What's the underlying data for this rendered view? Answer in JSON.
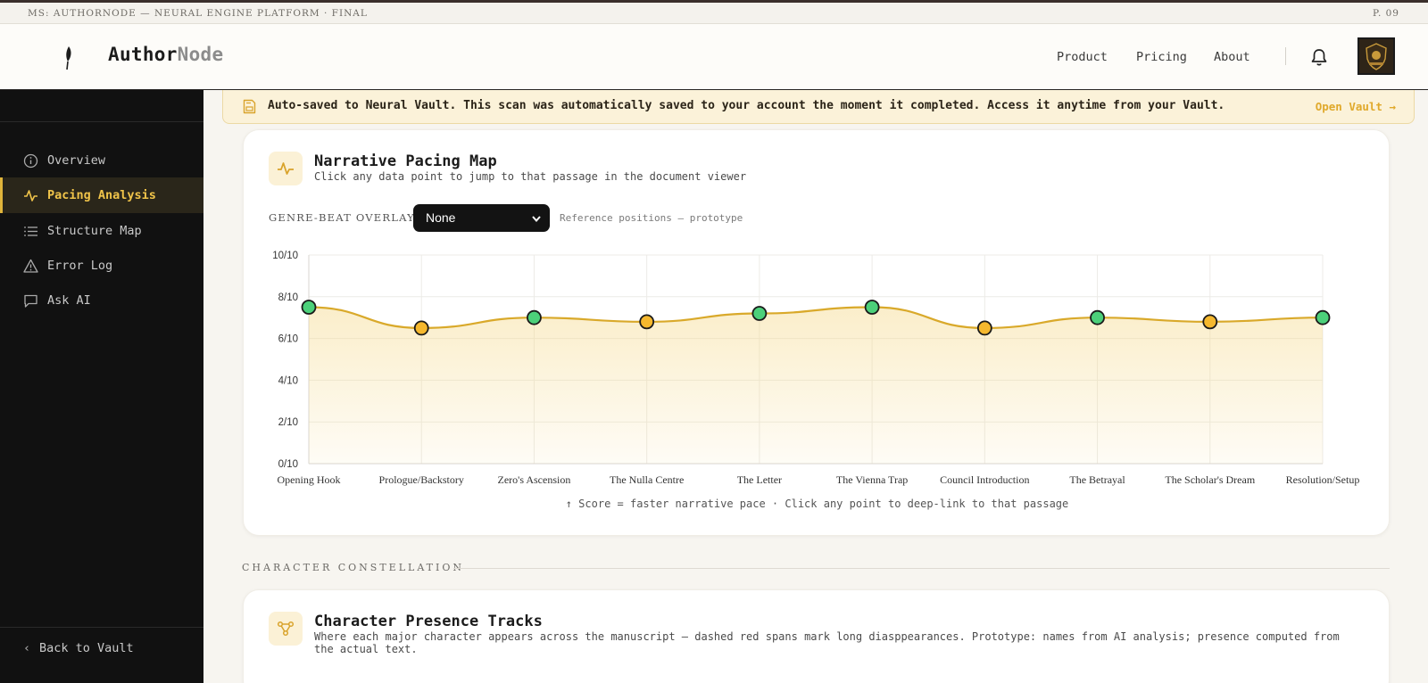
{
  "topstrip": {
    "left": "MS: AUTHORNODE — NEURAL ENGINE PLATFORM · FINAL",
    "right": "P. 09"
  },
  "header": {
    "brand_a": "Author",
    "brand_b": "Node",
    "nav": [
      "Product",
      "Pricing",
      "About"
    ],
    "icons": {
      "logo": "quill-icon",
      "notifications": "bell-icon",
      "avatar": "avatar-crest"
    }
  },
  "sidebar": {
    "items": [
      {
        "label": "Overview",
        "icon": "info-icon",
        "active": false
      },
      {
        "label": "Pacing Analysis",
        "icon": "activity-icon",
        "active": true
      },
      {
        "label": "Structure Map",
        "icon": "list-icon",
        "active": false
      },
      {
        "label": "Error Log",
        "icon": "warning-icon",
        "active": false
      },
      {
        "label": "Ask AI",
        "icon": "chat-icon",
        "active": false
      }
    ],
    "back_label": "Back to Vault"
  },
  "banner": {
    "text": "Auto-saved to Neural Vault. This scan was automatically saved to your account the moment it completed. Access it anytime from your Vault.",
    "link": "Open Vault →"
  },
  "pacing": {
    "title": "Narrative Pacing Map",
    "subtitle": "Click any data point to jump to that passage in the document viewer",
    "overlay_label": "GENRE-BEAT OVERLAY",
    "overlay_value": "None",
    "reference_note": "Reference positions — prototype",
    "footnote": "↑ Score = faster narrative pace · Click any point to deep-link to that passage"
  },
  "chart_data": {
    "type": "line",
    "categories": [
      "Opening Hook",
      "Prologue/Backstory",
      "Zero's Ascension",
      "The Nulla Centre",
      "The Letter",
      "The Vienna Trap",
      "Council Introduction",
      "The Betrayal",
      "The Scholar's Dream",
      "Resolution/Setup"
    ],
    "values": [
      7.5,
      6.5,
      7.0,
      6.8,
      7.2,
      7.5,
      6.5,
      7.0,
      6.8,
      7.0
    ],
    "point_colors": [
      "#4cd07a",
      "#f5b82e",
      "#4cd07a",
      "#f5b82e",
      "#4cd07a",
      "#4cd07a",
      "#f5b82e",
      "#4cd07a",
      "#f5b82e",
      "#4cd07a"
    ],
    "yticks": [
      "0/10",
      "2/10",
      "4/10",
      "6/10",
      "8/10",
      "10/10"
    ],
    "ylim": [
      0,
      10
    ],
    "line_color": "#d9a92a",
    "grid": true
  },
  "constellation": {
    "section_title": "CHARACTER CONSTELLATION",
    "title": "Character Presence Tracks",
    "subtitle": "Where each major character appears across the manuscript — dashed red spans mark long diasppearances. Prototype: names from AI analysis; presence computed from the actual text."
  }
}
